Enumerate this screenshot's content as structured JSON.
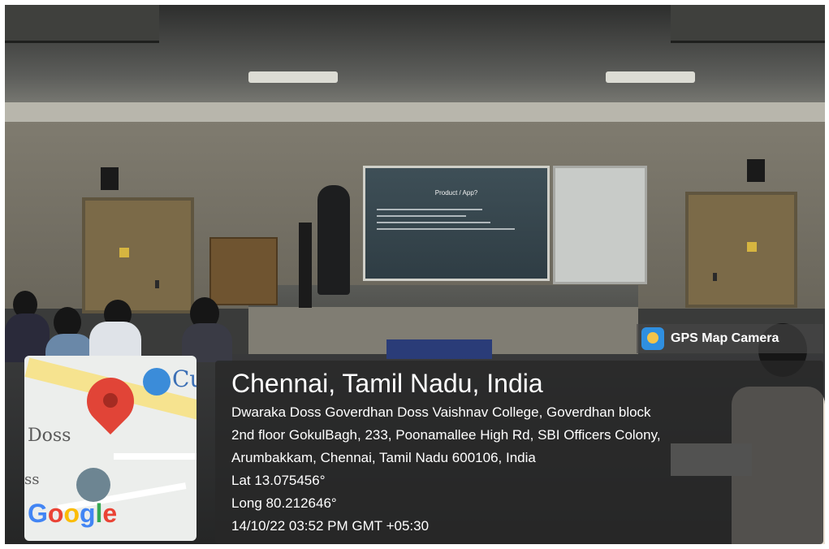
{
  "overlay": {
    "app_badge": "GPS Map Camera",
    "location_title": "Chennai, Tamil Nadu, India",
    "address_lines": [
      "Dwaraka Doss Goverdhan Doss Vaishnav College, Goverdhan block",
      "2nd floor GokulBagh, 233, Poonamallee High Rd, SBI Officers Colony,",
      "Arumbakkam, Chennai, Tamil Nadu 600106, India"
    ],
    "latitude": "Lat 13.075456°",
    "longitude": "Long 80.212646°",
    "timestamp": "14/10/22 03:52 PM GMT +05:30"
  },
  "map": {
    "labels": {
      "top_right": "Cu",
      "left_upper": "Doss",
      "left_lower": "ss"
    },
    "google_logo": [
      "G",
      "o",
      "o",
      "g",
      "l",
      "e"
    ],
    "google_colors": [
      "#4285F4",
      "#EA4335",
      "#FBBC05",
      "#4285F4",
      "#34A853",
      "#EA4335"
    ],
    "icons": [
      "map-pin-icon",
      "shopping-bag-icon",
      "graduation-cap-icon"
    ]
  },
  "slide": {
    "title": "Product / App?"
  },
  "colors": {
    "overlay_bg": "#282828",
    "pin": "#e14437",
    "badge_bg": "#464646"
  }
}
